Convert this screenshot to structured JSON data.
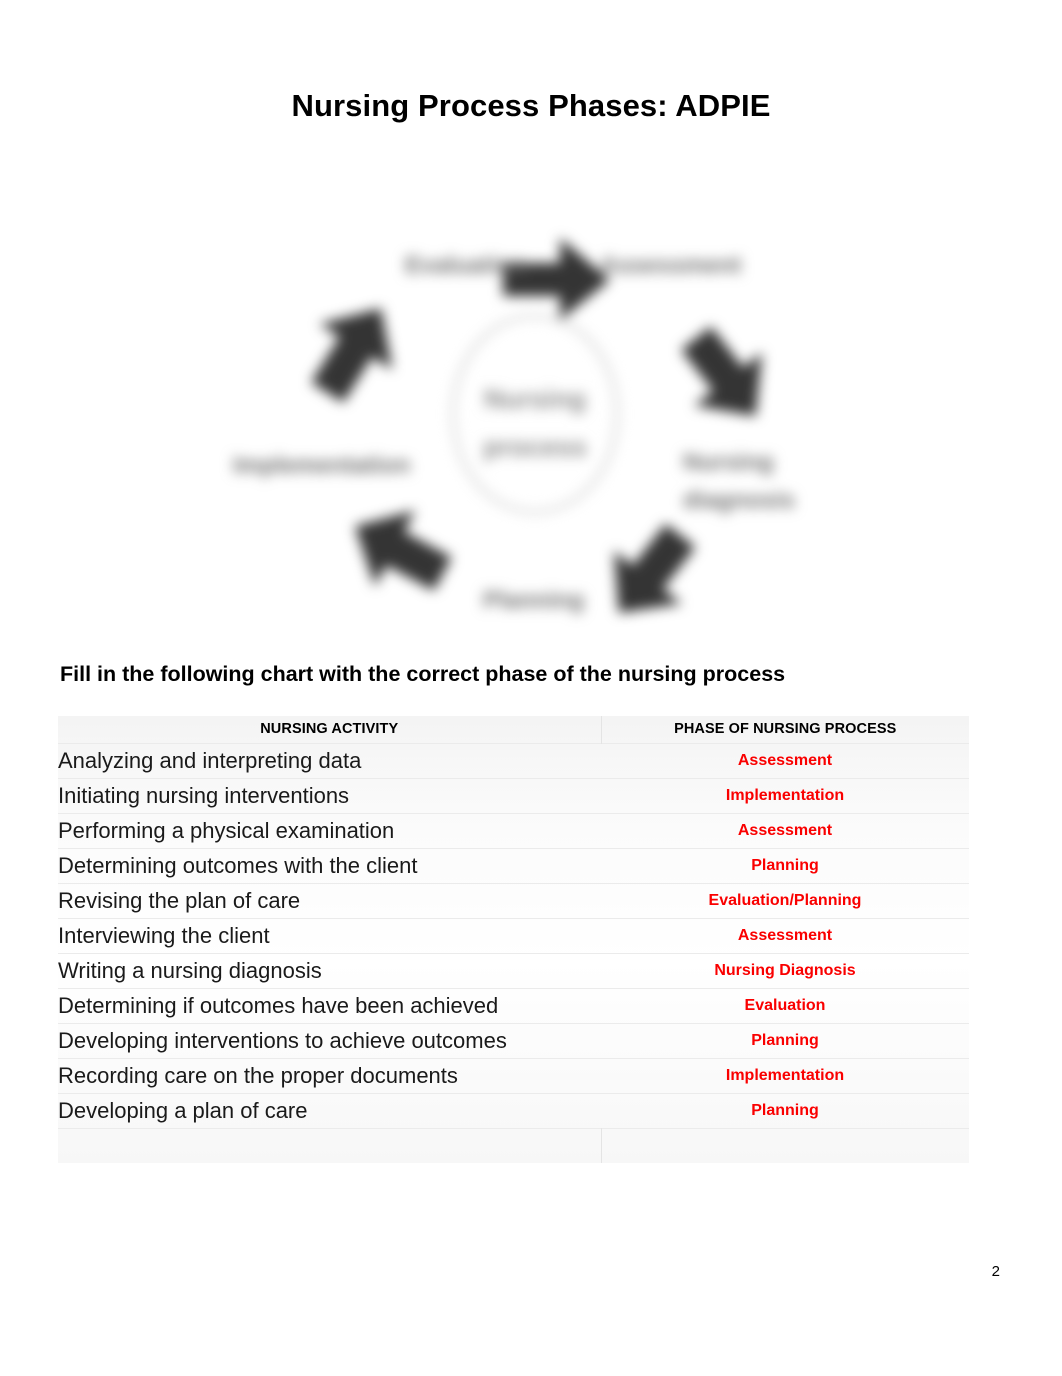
{
  "document": {
    "title": "Nursing Process Phases: ADPIE",
    "instruction": "Fill in the following chart with the correct phase of the nursing process",
    "page_number": "2"
  },
  "diagram": {
    "name": "nursing-process-cycle",
    "center_line1": "Nursing",
    "center_line2": "process",
    "labels": {
      "evaluation": "Evaluation",
      "assessment": "Assessment",
      "implementation": "Implementation",
      "nursing_diagnosis_line1": "Nursing",
      "nursing_diagnosis_line2": "diagnosis",
      "planning": "Planning"
    }
  },
  "table": {
    "headers": {
      "activity": "NURSING ACTIVITY",
      "phase": "PHASE OF NURSING PROCESS"
    },
    "rows": [
      {
        "activity": "Analyzing and interpreting data",
        "phase": "Assessment"
      },
      {
        "activity": "Initiating nursing interventions",
        "phase": "Implementation"
      },
      {
        "activity": "Performing a physical examination",
        "phase": "Assessment"
      },
      {
        "activity": "Determining outcomes with the client",
        "phase": "Planning"
      },
      {
        "activity": "Revising the plan of care",
        "phase": "Evaluation/Planning"
      },
      {
        "activity": "Interviewing the client",
        "phase": "Assessment"
      },
      {
        "activity": "Writing a nursing diagnosis",
        "phase": "Nursing Diagnosis"
      },
      {
        "activity": "Determining if outcomes have been achieved",
        "phase": "Evaluation"
      },
      {
        "activity": "Developing interventions to achieve outcomes",
        "phase": "Planning"
      },
      {
        "activity": "Recording care on the proper documents",
        "phase": "Implementation"
      },
      {
        "activity": "Developing a plan of care",
        "phase": "Planning"
      }
    ]
  },
  "colors": {
    "answer_red": "#fa0000",
    "text_black": "#1a1a1a",
    "diagram_dark": "#343434"
  }
}
